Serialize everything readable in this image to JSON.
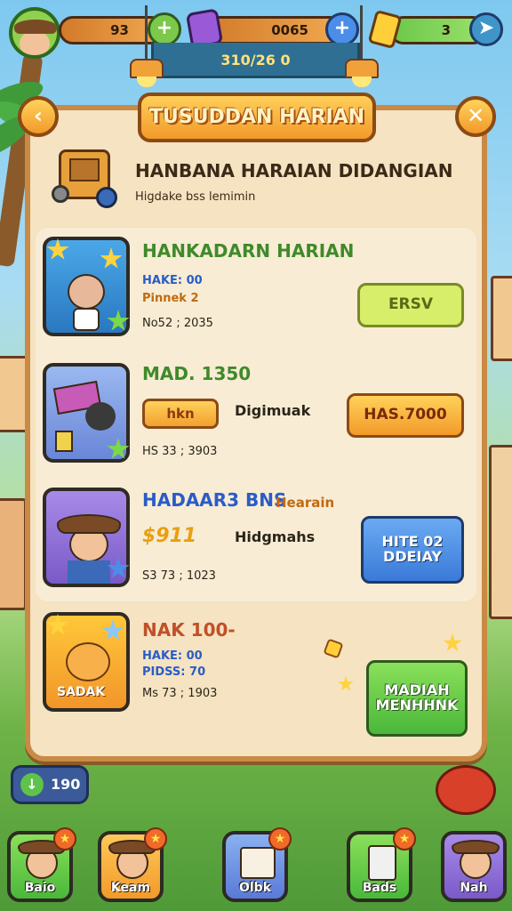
{
  "hud": {
    "resource1": "93",
    "resource2": "0065",
    "resource3": "3",
    "sub_readout": "310/26 0"
  },
  "panel": {
    "title": "TUSUDDAN HARIAN",
    "header_title": "HANBANA HARAIAN DIDANGIAN",
    "header_subtitle": "Higdake bss lemimin"
  },
  "rows": [
    {
      "title": "HANKADARN HARIAN",
      "title_color": "#3f8a2a",
      "line1": "HAKE: 00",
      "line2": "Pinnek 2",
      "line3": "No52 ; 2035",
      "button": "ERSV",
      "button_color": "#d6ee6a",
      "button_text_color": "#5a6a18"
    },
    {
      "title": "MAD. 1350",
      "title_color": "#3f8a2a",
      "tag": "hkn",
      "mid_label": "Digimuak",
      "line3": "HS 33 ; 3903",
      "button": "HAS.7000",
      "button_color": "#f7b33a",
      "button_text_color": "#7a2a08"
    },
    {
      "title": "HADAAR3 BNS",
      "title_suffix": "Hearain",
      "title_color": "#2a5cc8",
      "tag": "$911",
      "mid_label": "Hidgmahs",
      "line3": "S3 73 ; 1023",
      "button": "HITE 02 DDEIAY",
      "button_color": "#4a8ee8",
      "button_text_color": "#ffffff"
    },
    {
      "title": "NAK 100-",
      "title_color": "#c0502a",
      "line1": "HAKE: 00",
      "line2": "PIDSS: 70",
      "line3": "Ms 73 ; 1903",
      "thumb_label": "SADAK",
      "button": "MADIAH MENHHNK",
      "button_color": "#6ccf4a",
      "button_text_color": "#ffffff"
    }
  ],
  "chat": {
    "count": "190"
  },
  "nav": [
    {
      "label": "Baio"
    },
    {
      "label": "Keam"
    },
    {
      "label": "Olbk"
    },
    {
      "label": "Bads"
    },
    {
      "label": "Nah"
    }
  ]
}
